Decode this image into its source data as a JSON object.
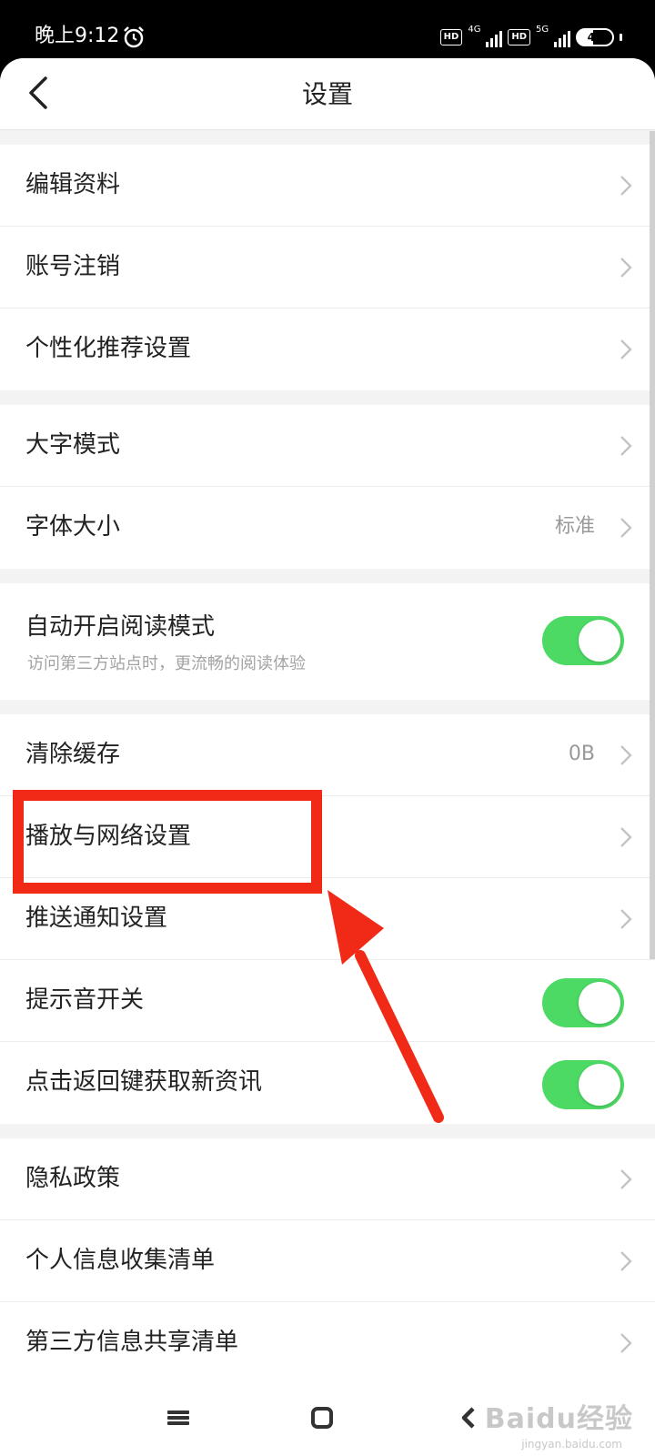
{
  "status_bar": {
    "time": "晚上9:12",
    "network_1": {
      "badge": "HD",
      "generation": "4G"
    },
    "network_2": {
      "badge": "HD",
      "generation": "5G"
    },
    "battery": "45"
  },
  "header": {
    "title": "设置"
  },
  "groups": [
    {
      "items": [
        {
          "label": "编辑资料"
        },
        {
          "label": "账号注销"
        },
        {
          "label": "个性化推荐设置"
        }
      ]
    },
    {
      "items": [
        {
          "label": "大字模式"
        },
        {
          "label": "字体大小",
          "value": "标准"
        }
      ]
    },
    {
      "items": [
        {
          "label": "自动开启阅读模式",
          "subtitle": "访问第三方站点时，更流畅的阅读体验",
          "toggle": true
        }
      ]
    },
    {
      "items": [
        {
          "label": "清除缓存",
          "value": "0B"
        },
        {
          "label": "播放与网络设置"
        },
        {
          "label": "推送通知设置"
        },
        {
          "label": "提示音开关",
          "toggle": true
        },
        {
          "label": "点击返回键获取新资讯",
          "toggle": true
        }
      ]
    },
    {
      "items": [
        {
          "label": "隐私政策"
        },
        {
          "label": "个人信息收集清单"
        },
        {
          "label": "第三方信息共享清单"
        }
      ]
    }
  ],
  "colors": {
    "toggle_on": "#4cd964",
    "highlight": "#f02a17",
    "background": "#f3f3f3"
  },
  "watermark": {
    "text": "Baidu经验",
    "sub": "jingyan.baidu.com"
  }
}
